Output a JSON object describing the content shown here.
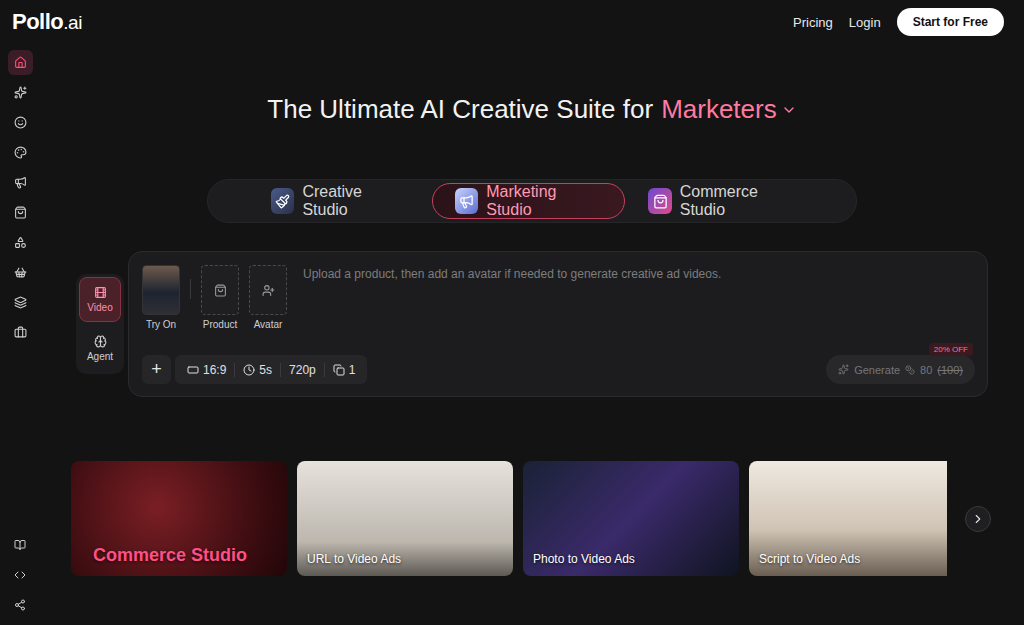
{
  "logo": {
    "text": "Pollo",
    "suffix": ".ai"
  },
  "header": {
    "links": [
      "Pricing",
      "Login"
    ],
    "cta": "Start for Free"
  },
  "sidebar": {
    "items": [
      {
        "selected": true
      },
      {
        "selected": false
      },
      {
        "selected": false
      },
      {
        "selected": false
      },
      {
        "selected": false
      },
      {
        "selected": false
      },
      {
        "selected": false
      },
      {
        "selected": false
      },
      {
        "selected": false
      },
      {
        "selected": false
      }
    ],
    "bottom_items": [
      {
        "selected": false
      },
      {
        "selected": false
      },
      {
        "selected": false
      }
    ]
  },
  "headline": {
    "text": "The Ultimate AI Creative Suite for",
    "highlight": "Marketers"
  },
  "studio_tabs": [
    {
      "label": "Creative Studio",
      "selected": false
    },
    {
      "label": "Marketing Studio",
      "selected": true
    },
    {
      "label": "Commerce Studio",
      "selected": false
    }
  ],
  "composer": {
    "modes": [
      {
        "label": "Video",
        "selected": true
      },
      {
        "label": "Agent",
        "selected": false
      }
    ],
    "attachments": [
      {
        "label": "Try On",
        "kind": "photo"
      },
      {
        "label": "Product",
        "kind": "empty"
      },
      {
        "label": "Avatar",
        "kind": "empty"
      }
    ],
    "placeholder": "Upload a product, then add an avatar if needed to generate creative ad videos.",
    "add_button": "+",
    "options": [
      "16:9",
      "5s",
      "720p",
      "1"
    ],
    "generate": {
      "label": "Generate",
      "cost": "80",
      "original_cost": "(100)",
      "badge": "20% OFF",
      "disabled": true
    }
  },
  "cards": [
    {
      "title": "Commerce Studio",
      "kind": "brand"
    },
    {
      "title": "URL to Video Ads",
      "kind": "caption"
    },
    {
      "title": "Photo to Video Ads",
      "kind": "caption"
    },
    {
      "title": "Script to Video Ads",
      "kind": "caption"
    }
  ]
}
